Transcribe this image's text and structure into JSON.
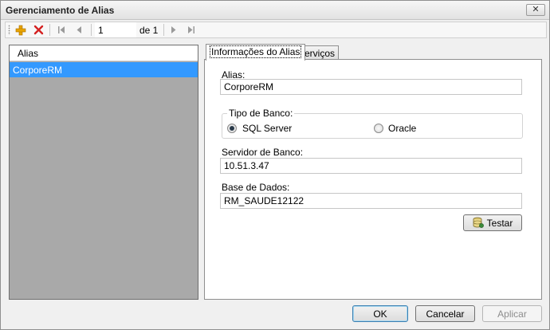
{
  "window": {
    "title": "Gerenciamento de Alias",
    "close_symbol": "✕"
  },
  "toolbar": {
    "icons": [
      "add-icon",
      "delete-icon",
      "first-page-icon",
      "previous-page-icon",
      "next-page-icon",
      "last-page-icon"
    ],
    "page_value": "1",
    "of_label": "de 1"
  },
  "alias_list": {
    "header": "Alias",
    "items": [
      "CorporeRM"
    ],
    "selected_index": 0
  },
  "tabs": [
    {
      "label": "Informações do Alias",
      "active": true
    },
    {
      "label": "Serviços",
      "active": false
    }
  ],
  "form": {
    "alias_label": "Alias:",
    "alias_value": "CorporeRM",
    "db_type_label": "Tipo de Banco:",
    "db_type_options": [
      {
        "label": "SQL Server",
        "checked": true
      },
      {
        "label": "Oracle",
        "checked": false
      }
    ],
    "server_label": "Servidor de Banco:",
    "server_value": "10.51.3.47",
    "database_label": "Base de Dados:",
    "database_value": "RM_SAUDE12122",
    "test_button": "Testar"
  },
  "footer": {
    "ok": "OK",
    "cancel": "Cancelar",
    "apply": "Aplicar"
  },
  "colors": {
    "selection": "#3399ff",
    "list_background": "#a9a9a9",
    "add_icon": "#e8a400",
    "delete_icon": "#d42020"
  }
}
